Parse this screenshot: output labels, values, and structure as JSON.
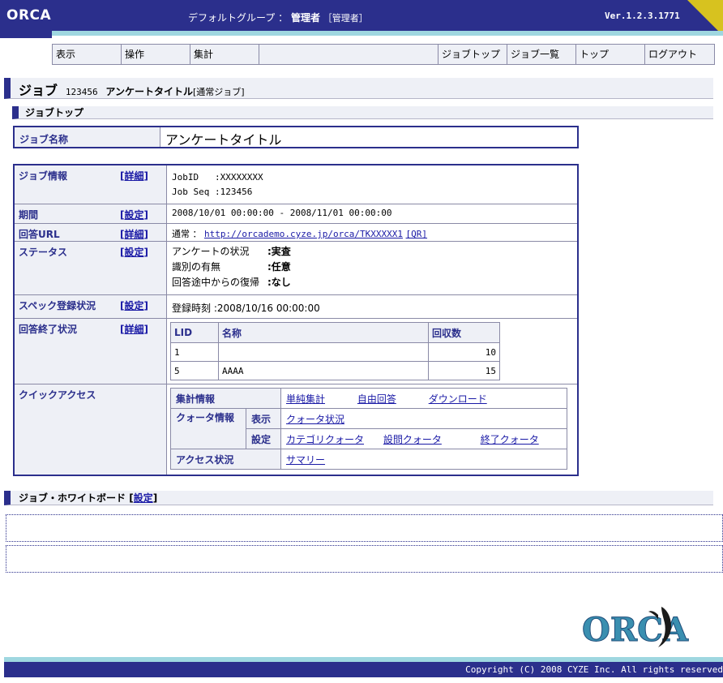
{
  "header": {
    "logo": "ORCA",
    "group": "デフォルトグループ ：",
    "user": "管理者",
    "role": "［管理者］",
    "version": "Ver.1.2.3.1771"
  },
  "nav": {
    "left": [
      "表示",
      "操作",
      "集計"
    ],
    "right": [
      "ジョブトップ",
      "ジョブ一覧",
      "トップ",
      "ログアウト"
    ]
  },
  "job_bar": {
    "title": "ジョブ",
    "id": "123456",
    "name": "アンケートタイトル",
    "type": "[通常ジョブ]"
  },
  "jobtop_bar": {
    "title": "ジョブトップ"
  },
  "jobname": {
    "label": "ジョブ名称",
    "value": "アンケートタイトル"
  },
  "info": {
    "jobinfo": {
      "label": "ジョブ情報",
      "action": "詳細",
      "lines": [
        "JobID   :XXXXXXXX",
        "Job Seq :123456"
      ]
    },
    "period": {
      "label": "期間",
      "action": "設定",
      "value": "2008/10/01 00:00:00 - 2008/11/01 00:00:00"
    },
    "url": {
      "label": "回答URL",
      "action": "詳細",
      "prefix": "通常 ：",
      "link": "http://orcademo.cyze.jp/orca/TKXXXXX1",
      "qr": "[QR]"
    },
    "status": {
      "label": "ステータス",
      "action": "設定",
      "items": [
        {
          "key": "アンケートの状況",
          "value": ":実査"
        },
        {
          "key": "識別の有無",
          "value": ":任意"
        },
        {
          "key": "回答途中からの復帰",
          "value": ":なし"
        }
      ]
    },
    "spec": {
      "label": "スペック登録状況",
      "action": "設定",
      "value": "登録時刻 :2008/10/16 00:00:00"
    },
    "finish": {
      "label": "回答終了状況",
      "action": "詳細",
      "columns": [
        "LID",
        "名称",
        "回収数"
      ],
      "rows": [
        {
          "lid": "1",
          "name": "",
          "count": "10"
        },
        {
          "lid": "5",
          "name": "AAAA",
          "count": "15"
        }
      ]
    },
    "quick": {
      "label": "クイックアクセス",
      "aggregate": {
        "head": "集計情報",
        "links": [
          "単純集計",
          "自由回答",
          "ダウンロード"
        ]
      },
      "quota": {
        "head": "クォータ情報",
        "view_label": "表示",
        "view_links": [
          "クォータ状況"
        ],
        "set_label": "設定",
        "set_links": [
          "カテゴリクォータ",
          "設問クォータ",
          "終了クォータ"
        ]
      },
      "access": {
        "head": "アクセス状況",
        "links": [
          "サマリー"
        ]
      }
    }
  },
  "whiteboard": {
    "title": "ジョブ・ホワイトボード",
    "action": "設定"
  },
  "footer": {
    "copyright": "Copyright (C) 2008 CYZE Inc. All rights reserved",
    "logo": "ORCA"
  },
  "colors": {
    "primary": "#2b2f8c",
    "accent": "#9fd7e0",
    "gold": "#d7c21f"
  }
}
